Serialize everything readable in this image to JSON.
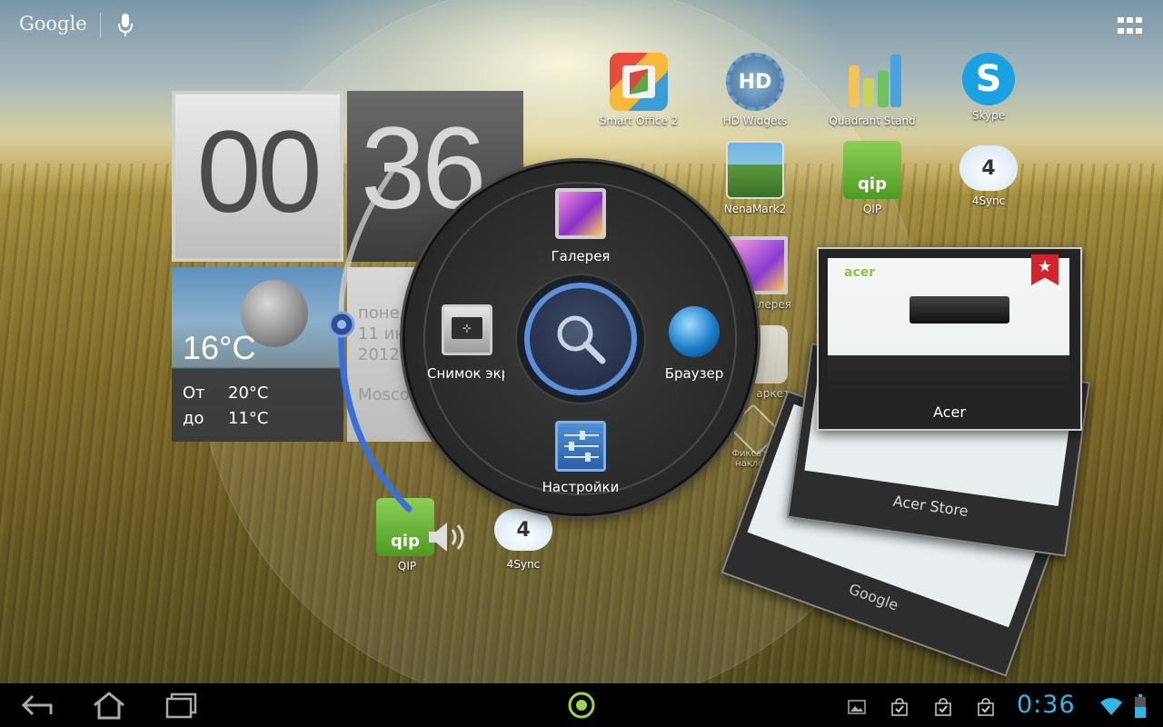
{
  "top_bar": {
    "search_label": "Google"
  },
  "clock_widget": {
    "hours": "00",
    "minutes": "36",
    "temperature": "16°C",
    "high_label": "От",
    "high_value": "20°C",
    "low_label": "до",
    "low_value": "11°C",
    "day": "понед",
    "date": "11 ию",
    "year": "2012",
    "city": "Mosco"
  },
  "radial_menu": {
    "items": [
      {
        "label": "Галерея",
        "icon": "gallery-icon"
      },
      {
        "label": "Снимок экр",
        "icon": "screenshot-icon"
      },
      {
        "label": "Браузер",
        "icon": "browser-globe-icon"
      },
      {
        "label": "Настройки",
        "icon": "settings-sliders-icon"
      }
    ],
    "center_icon": "search-icon",
    "accent": "#5c8fd9"
  },
  "desktop_apps": [
    {
      "label": "Smart Office 2",
      "icon": "smart-office-icon"
    },
    {
      "label": "HD Widgets",
      "icon": "hd-widgets-icon"
    },
    {
      "label": "Quadrant Stand",
      "icon": "quadrant-icon"
    },
    {
      "label": "Skype",
      "icon": "skype-icon"
    },
    {
      "label": "NenaMark2",
      "icon": "nenamark-icon"
    },
    {
      "label": "QIP",
      "icon": "qip-icon"
    },
    {
      "label": "4Sync",
      "icon": "4sync-icon"
    },
    {
      "label": "лерея",
      "icon": "gallery-icon"
    },
    {
      "label": "аркет",
      "icon": "market-icon"
    },
    {
      "label": "Фиксатор наклона",
      "icon": "rotation-lock-icon"
    },
    {
      "label": "QIP",
      "icon": "qip-icon"
    },
    {
      "label": "4Sync",
      "icon": "4sync-icon"
    }
  ],
  "recent_apps": [
    {
      "title": "Acer"
    },
    {
      "title": "Acer Store"
    },
    {
      "title": "Google"
    }
  ],
  "nav_bar": {
    "clock": "0:36",
    "clock_color": "#33b5e5",
    "icons": [
      "back-icon",
      "home-icon",
      "recent-apps-icon",
      "ring-launcher-icon",
      "gallery-notification-icon",
      "download-complete-icon",
      "wifi-icon",
      "battery-icon"
    ]
  }
}
